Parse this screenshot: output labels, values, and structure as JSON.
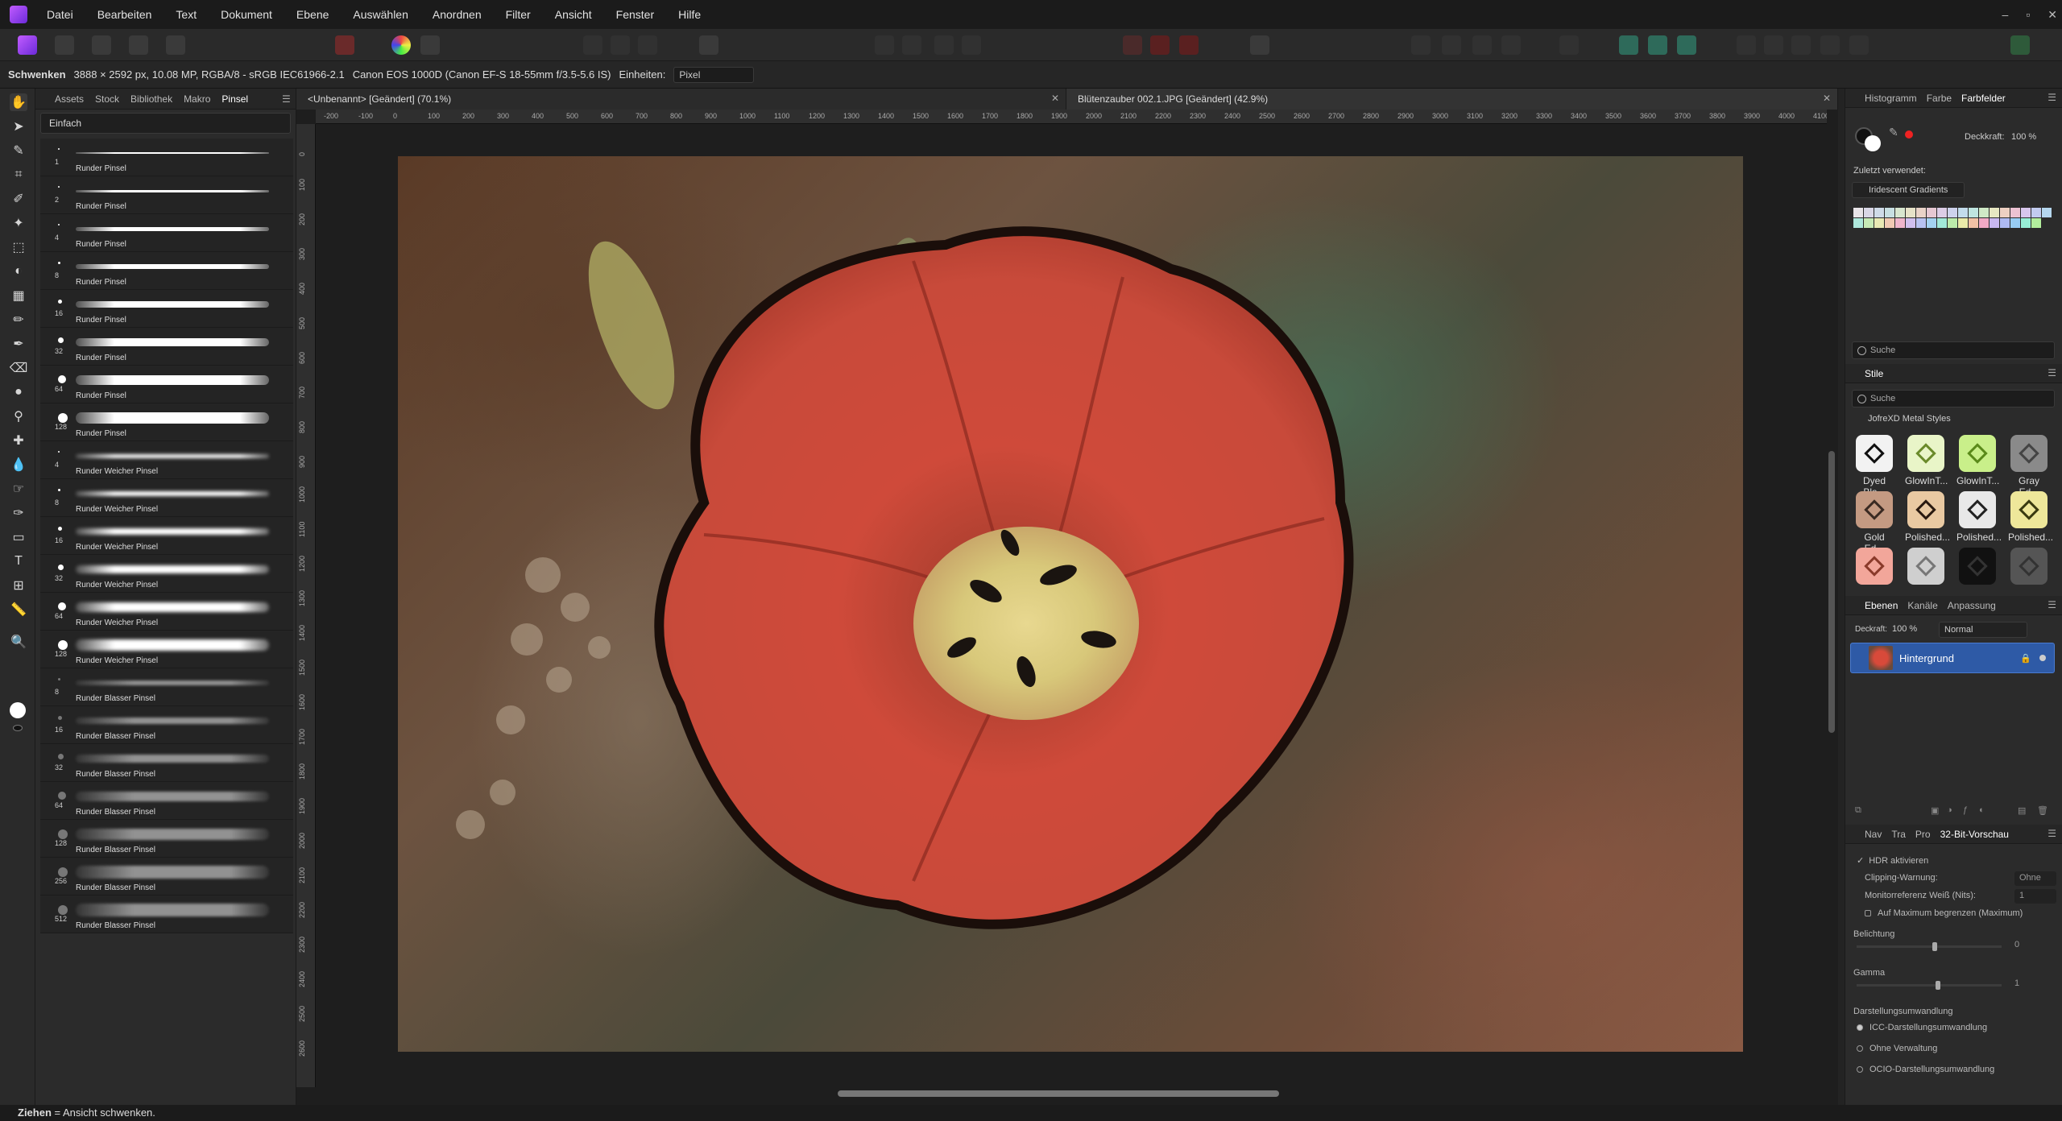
{
  "menu": [
    "Datei",
    "Bearbeiten",
    "Text",
    "Dokument",
    "Ebene",
    "Auswählen",
    "Anordnen",
    "Filter",
    "Ansicht",
    "Fenster",
    "Hilfe"
  ],
  "window_controls": [
    "–",
    "▫",
    "✕"
  ],
  "context": {
    "tool": "Schwenken",
    "info": "3888 × 2592 px, 10.08 MP, RGBA/8 - sRGB IEC61966-2.1",
    "camera": "Canon EOS 1000D (Canon EF-S 18-55mm f/3.5-5.6 IS)",
    "units_label": "Einheiten:",
    "units_value": "Pixel"
  },
  "left_tabs": [
    "Assets",
    "Stock",
    "Bibliothek",
    "Makro",
    "Pinsel"
  ],
  "brush_category": "Einfach",
  "brushes": [
    {
      "size": "1",
      "name": "Runder Pinsel",
      "style": "hard"
    },
    {
      "size": "2",
      "name": "Runder Pinsel",
      "style": "hard"
    },
    {
      "size": "4",
      "name": "Runder Pinsel",
      "style": "hard"
    },
    {
      "size": "8",
      "name": "Runder Pinsel",
      "style": "hard"
    },
    {
      "size": "16",
      "name": "Runder Pinsel",
      "style": "hard"
    },
    {
      "size": "32",
      "name": "Runder Pinsel",
      "style": "hard"
    },
    {
      "size": "64",
      "name": "Runder Pinsel",
      "style": "hard"
    },
    {
      "size": "128",
      "name": "Runder Pinsel",
      "style": "hard"
    },
    {
      "size": "4",
      "name": "Runder Weicher Pinsel",
      "style": "soft"
    },
    {
      "size": "8",
      "name": "Runder Weicher Pinsel",
      "style": "soft"
    },
    {
      "size": "16",
      "name": "Runder Weicher Pinsel",
      "style": "soft"
    },
    {
      "size": "32",
      "name": "Runder Weicher Pinsel",
      "style": "soft"
    },
    {
      "size": "64",
      "name": "Runder Weicher Pinsel",
      "style": "soft"
    },
    {
      "size": "128",
      "name": "Runder Weicher Pinsel",
      "style": "soft"
    },
    {
      "size": "8",
      "name": "Runder Blasser Pinsel",
      "style": "faint"
    },
    {
      "size": "16",
      "name": "Runder Blasser Pinsel",
      "style": "faint"
    },
    {
      "size": "32",
      "name": "Runder Blasser Pinsel",
      "style": "faint"
    },
    {
      "size": "64",
      "name": "Runder Blasser Pinsel",
      "style": "faint"
    },
    {
      "size": "128",
      "name": "Runder Blasser Pinsel",
      "style": "faint"
    },
    {
      "size": "256",
      "name": "Runder Blasser Pinsel",
      "style": "faint"
    },
    {
      "size": "512",
      "name": "Runder Blasser Pinsel",
      "style": "faint"
    }
  ],
  "doc_tabs": [
    {
      "title": "<Unbenannt> [Geändert] (70.1%)"
    },
    {
      "title": "Blütenzauber 002.1.JPG [Geändert] (42.9%)"
    }
  ],
  "ruler_h": [
    "-200",
    "-100",
    "0",
    "100",
    "200",
    "300",
    "400",
    "500",
    "600",
    "700",
    "800",
    "900",
    "1000",
    "1100",
    "1200",
    "1300",
    "1400",
    "1500",
    "1600",
    "1700",
    "1800",
    "1900",
    "2000",
    "2100",
    "2200",
    "2300",
    "2400",
    "2500",
    "2600",
    "2700",
    "2800",
    "2900",
    "3000",
    "3100",
    "3200",
    "3300",
    "3400",
    "3500",
    "3600",
    "3700",
    "3800",
    "3900",
    "4000",
    "4100"
  ],
  "ruler_v": [
    "0",
    "100",
    "200",
    "300",
    "400",
    "500",
    "600",
    "700",
    "800",
    "900",
    "1000",
    "1100",
    "1200",
    "1300",
    "1400",
    "1500",
    "1600",
    "1700",
    "1800",
    "1900",
    "2000",
    "2100",
    "2200",
    "2300",
    "2400",
    "2500",
    "2600"
  ],
  "right": {
    "color_tabs": [
      "Histogramm",
      "Farbe",
      "Farbfelder"
    ],
    "opacity_label": "Deckkraft:",
    "opacity_value": "100 %",
    "recent_label": "Zuletzt verwendet:",
    "palette": "Iridescent Gradients",
    "swatch_colors": [
      "#e8e4e8",
      "#d9d7e6",
      "#cfdbe8",
      "#c8dfe2",
      "#d8e6cf",
      "#e6e2c8",
      "#e9d3c8",
      "#e6c8d3",
      "#dccde6",
      "#cdd2ec",
      "#c3dcec",
      "#bfe5e0",
      "#cfe9c6",
      "#e7e7c2",
      "#eed0c2",
      "#ecc2d2",
      "#d7c6ec",
      "#c2cbef",
      "#b5d7ef",
      "#aee8dc",
      "#c6eab6",
      "#e8e9b4",
      "#f0c9b3",
      "#efb5cb",
      "#d0bfee",
      "#b8c2f1",
      "#a4d2f1",
      "#a2e9d8",
      "#bcebaa",
      "#eaeaa8",
      "#f1c1a5",
      "#f1a9c5",
      "#c9b7f0",
      "#aebaf3",
      "#98cdf4",
      "#97eed6",
      "#b2ee9d"
    ],
    "swatch_search": "Suche",
    "styles_tab": "Stile",
    "styles_search": "Suche",
    "styles_category": "JofreXD Metal Styles",
    "styles": [
      {
        "name": "Dyed Bla...",
        "bg": "#f2f2f2",
        "fg": "#111"
      },
      {
        "name": "GlowInT...",
        "bg": "#e9f5c8",
        "fg": "#6a8a2a"
      },
      {
        "name": "GlowInT...",
        "bg": "#c9ef8a",
        "fg": "#5a8a1a"
      },
      {
        "name": "Gray Ed...",
        "bg": "#8a8a8a",
        "fg": "#444"
      },
      {
        "name": "Gold Ed...",
        "bg": "#c49a82",
        "fg": "#3a2a22"
      },
      {
        "name": "Polished...",
        "bg": "#e9c9a2",
        "fg": "#2a1a10"
      },
      {
        "name": "Polished...",
        "bg": "#e8e8e8",
        "fg": "#222"
      },
      {
        "name": "Polished...",
        "bg": "#eee79a",
        "fg": "#3a3a10"
      },
      {
        "name": "",
        "bg": "#f2a69a",
        "fg": "#8a3a2a"
      },
      {
        "name": "",
        "bg": "#cfcfcf",
        "fg": "#777"
      },
      {
        "name": "",
        "bg": "#111",
        "fg": "#333"
      },
      {
        "name": "",
        "bg": "#555",
        "fg": "#333"
      }
    ],
    "layer_tabs": [
      "Ebenen",
      "Kanäle",
      "Anpassung"
    ],
    "layer_opacity_label": "Deckraft:",
    "layer_opacity": "100 %",
    "blend_mode": "Normal",
    "layer_name": "Hintergrund",
    "nav_tabs": [
      "Nav",
      "Tra",
      "Pro",
      "32-Bit-Vorschau"
    ],
    "hdr_label": "HDR aktivieren",
    "clip_label": "Clipping-Warnung:",
    "clip_value": "Ohne",
    "monitor_label": "Monitorreferenz Weiß (Nits):",
    "monitor_value": "1",
    "max_label": "Auf Maximum begrenzen (Maximum)",
    "exposure_label": "Belichtung",
    "exposure_value": "0",
    "gamma_label": "Gamma",
    "gamma_value": "1",
    "display_label": "Darstellungsumwandlung",
    "display_opts": [
      "ICC-Darstellungsumwandlung",
      "Ohne Verwaltung",
      "OCIO-Darstellungsumwandlung"
    ]
  },
  "status": {
    "bold": "Ziehen",
    "text": " = Ansicht schwenken."
  }
}
